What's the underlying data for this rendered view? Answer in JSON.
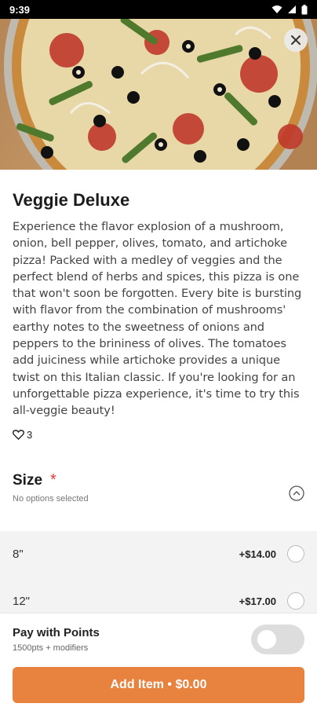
{
  "status_bar": {
    "time": "9:39"
  },
  "product": {
    "title": "Veggie Deluxe",
    "description": "Experience the flavor explosion of a mushroom, onion, bell pepper, olives, tomato, and artichoke pizza! Packed with a medley of veggies and the perfect blend of herbs and spices, this pizza is one that won't soon be forgotten. Every bite is bursting with flavor from the combination of mushrooms' earthy notes to the sweetness of onions and peppers to the brininess of olives. The tomatoes add juiciness while artichoke provides a unique twist on this Italian classic. If you're looking for an unforgettable pizza experience, it's time to try this all-veggie beauty!",
    "likes": "3"
  },
  "size_section": {
    "title": "Size",
    "required_marker": "*",
    "subtitle": "No options selected",
    "options": [
      {
        "label": "8\"",
        "price": "+$14.00"
      },
      {
        "label": "12\"",
        "price": "+$17.00"
      }
    ]
  },
  "points": {
    "title": "Pay with Points",
    "subtitle": "1500pts + modifiers"
  },
  "add_button": {
    "label": "Add Item • $0.00"
  },
  "colors": {
    "accent": "#e8823f",
    "required": "#e53935"
  }
}
